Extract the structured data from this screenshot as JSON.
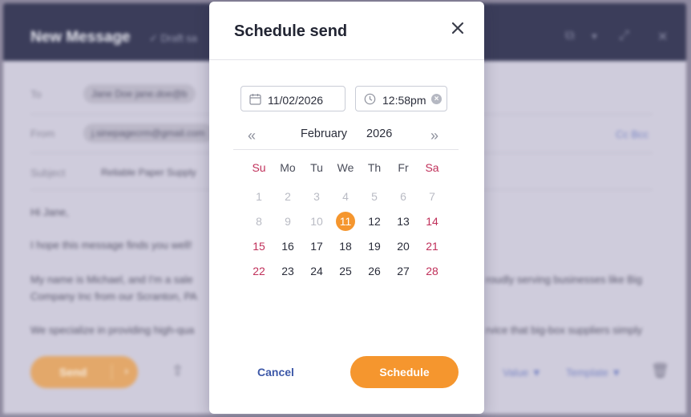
{
  "background": {
    "window_title": "New Message",
    "draft_status": "✓ Draft sa",
    "to_label": "To",
    "to_chip": "Jane Doe jane.doe@b",
    "from_label": "From",
    "from_value": "j.sinepagecrm@gmail.com",
    "subject_label": "Subject",
    "subject_value": "Reliable Paper Supply",
    "cc_bcc": "Cc  Bcc",
    "body_lines": [
      "Hi Jane,",
      "I hope this message finds you well!",
      "My name is Michael, and I'm a sale",
      "Company Inc from our Scranton, PA",
      "We specialize in providing high-qua"
    ],
    "body_right_lines": [
      "roudly serving businesses like Big",
      "rvice that big-box suppliers simply"
    ],
    "send_label": "Send",
    "value_label": "Value ▼",
    "template_label": "Template ▼"
  },
  "modal": {
    "title": "Schedule send",
    "date_value": "11/02/2026",
    "time_value": "12:58pm",
    "nav_prev": "«",
    "nav_next": "»",
    "month": "February",
    "year": "2026",
    "weekdays": [
      "Su",
      "Mo",
      "Tu",
      "We",
      "Th",
      "Fr",
      "Sa"
    ],
    "weeks": [
      [
        "1",
        "2",
        "3",
        "4",
        "5",
        "6",
        "7"
      ],
      [
        "8",
        "9",
        "10",
        "11",
        "12",
        "13",
        "14"
      ],
      [
        "15",
        "16",
        "17",
        "18",
        "19",
        "20",
        "21"
      ],
      [
        "22",
        "23",
        "24",
        "25",
        "26",
        "27",
        "28"
      ]
    ],
    "selected_day": "11",
    "cancel_label": "Cancel",
    "schedule_label": "Schedule"
  },
  "colors": {
    "accent": "#f5962e",
    "weekend": "#c0305a",
    "link": "#3d58a8"
  }
}
